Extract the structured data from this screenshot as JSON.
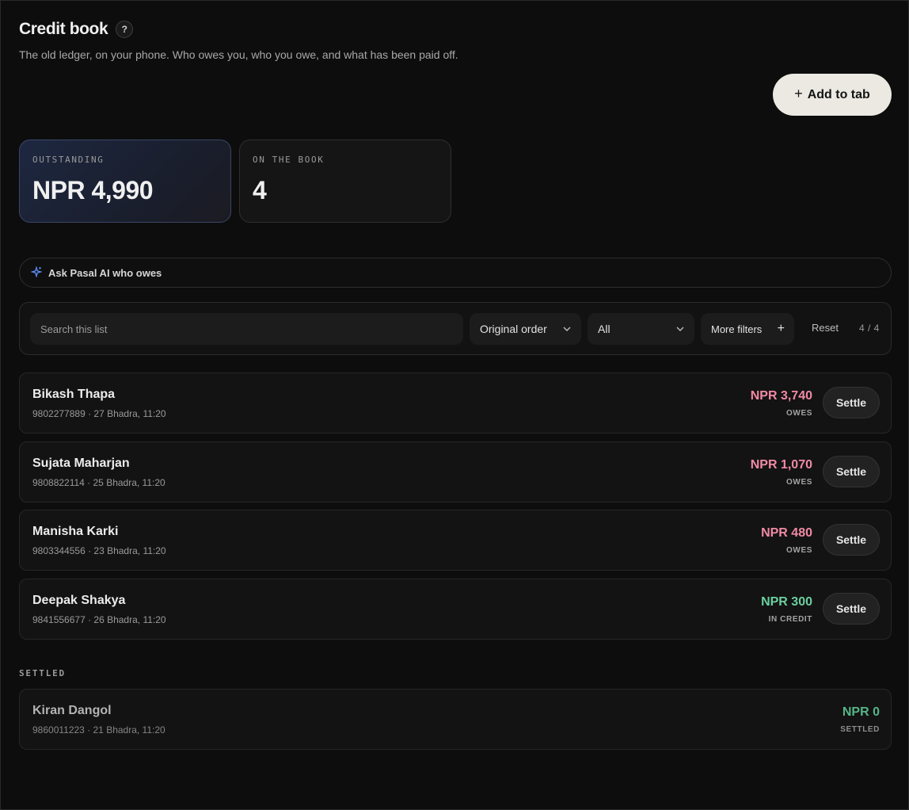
{
  "header": {
    "title": "Credit book",
    "help_label": "?",
    "subtitle": "The old ledger, on your phone. Who owes you, who you owe, and what has been paid off.",
    "add_button_label": "Add to tab",
    "add_icon": "plus-icon"
  },
  "stats": {
    "outstanding_label": "OUTSTANDING",
    "outstanding_value": "NPR 4,990",
    "on_book_label": "ON THE BOOK",
    "on_book_value": "4"
  },
  "ask_ai": {
    "label": "Ask Pasal AI who owes",
    "icon": "sparkle-icon",
    "icon_color": "#5b8cf5"
  },
  "filters": {
    "search_placeholder": "Search this list",
    "order_value": "Original order",
    "status_value": "All",
    "more_filters_label": "More filters",
    "reset_label": "Reset",
    "count": "4 / 4"
  },
  "colors": {
    "owes": "#f08aa4",
    "credit": "#6bcfa0",
    "settled": "#56b588"
  },
  "entries": [
    {
      "name": "Bikash Thapa",
      "meta": "9802277889 · 27 Bhadra, 11:20",
      "amount": "NPR 3,740",
      "status": "OWES",
      "button": "Settle"
    },
    {
      "name": "Sujata Maharjan",
      "meta": "9808822114 · 25 Bhadra, 11:20",
      "amount": "NPR 1,070",
      "status": "OWES",
      "button": "Settle"
    },
    {
      "name": "Manisha Karki",
      "meta": "9803344556 · 23 Bhadra, 11:20",
      "amount": "NPR 480",
      "status": "OWES",
      "button": "Settle"
    },
    {
      "name": "Deepak Shakya",
      "meta": "9841556677 · 26 Bhadra, 11:20",
      "amount": "NPR 300",
      "status": "IN CREDIT",
      "button": "Settle"
    }
  ],
  "settled_section": {
    "label": "SETTLED",
    "entries": [
      {
        "name": "Kiran Dangol",
        "meta": "9860011223 · 21 Bhadra, 11:20",
        "amount": "NPR 0",
        "status": "SETTLED"
      }
    ]
  }
}
